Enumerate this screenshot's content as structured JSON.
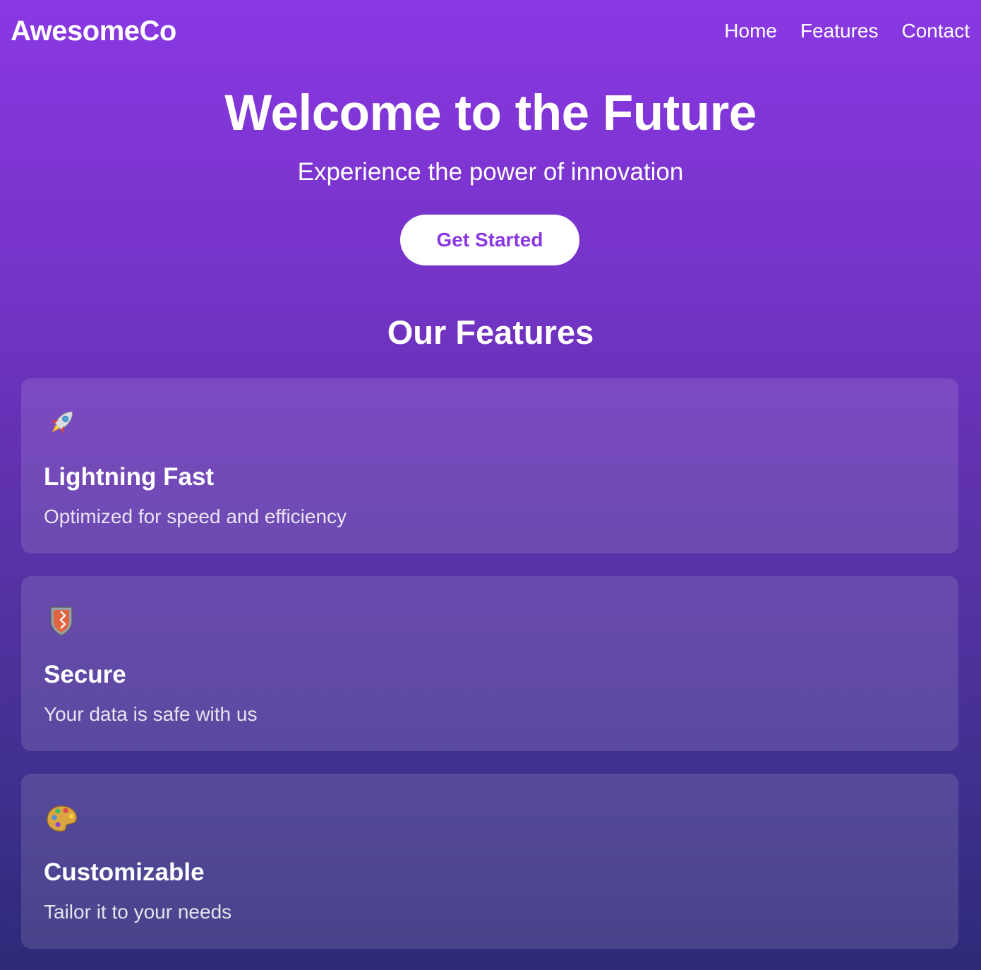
{
  "nav": {
    "logo": "AwesomeCo",
    "links": [
      {
        "label": "Home"
      },
      {
        "label": "Features"
      },
      {
        "label": "Contact"
      }
    ]
  },
  "hero": {
    "title": "Welcome to the Future",
    "subtitle": "Experience the power of innovation",
    "cta_label": "Get Started"
  },
  "features": {
    "title": "Our Features",
    "items": [
      {
        "icon": "rocket-icon",
        "title": "Lightning Fast",
        "description": "Optimized for speed and efficiency"
      },
      {
        "icon": "shield-icon",
        "title": "Secure",
        "description": "Your data is safe with us"
      },
      {
        "icon": "palette-icon",
        "title": "Customizable",
        "description": "Tailor it to your needs"
      }
    ]
  },
  "colors": {
    "accent": "#8a38e3",
    "background_top": "#8a38e3",
    "background_bottom": "#2d2a78",
    "text": "#ffffff"
  }
}
